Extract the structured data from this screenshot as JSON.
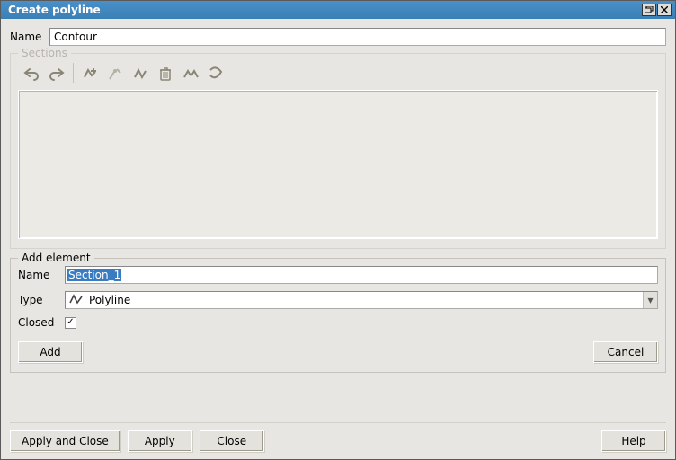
{
  "title": "Create polyline",
  "name_field": {
    "label": "Name",
    "value": "Contour"
  },
  "sections": {
    "legend": "Sections"
  },
  "add_element": {
    "legend": "Add element",
    "name": {
      "label": "Name",
      "value": "Section_1"
    },
    "type": {
      "label": "Type",
      "value": "Polyline"
    },
    "closed": {
      "label": "Closed",
      "checked": true
    },
    "add_btn": "Add",
    "cancel_btn": "Cancel"
  },
  "footer": {
    "apply_close": "Apply and Close",
    "apply": "Apply",
    "close": "Close",
    "help": "Help"
  },
  "icons": {
    "check": "✓",
    "dropdown": "▾"
  }
}
